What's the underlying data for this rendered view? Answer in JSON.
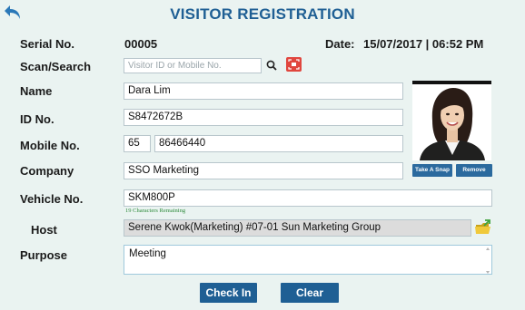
{
  "header": {
    "title": "VISITOR REGISTRATION"
  },
  "serial": {
    "label": "Serial No.",
    "value": "00005"
  },
  "date": {
    "label": "Date:",
    "value": "15/07/2017 | 06:52 PM"
  },
  "scan": {
    "label": "Scan/Search",
    "placeholder": "Visitor ID or Mobile No."
  },
  "name": {
    "label": "Name",
    "value": "Dara Lim"
  },
  "id_no": {
    "label": "ID No.",
    "value": "S8472672B"
  },
  "mobile": {
    "label": "Mobile No.",
    "country_code": "65",
    "number": "86466440"
  },
  "company": {
    "label": "Company",
    "value": "SSO Marketing"
  },
  "vehicle": {
    "label": "Vehicle No.",
    "value": "SKM800P",
    "hint": "19 Characters Remaining"
  },
  "host": {
    "label": "Host",
    "value": "Serene Kwok(Marketing) #07-01 Sun Marketing Group"
  },
  "purpose": {
    "label": "Purpose",
    "value": "Meeting"
  },
  "photo_buttons": {
    "snap": "Take A Snap",
    "remove": "Remove"
  },
  "actions": {
    "check_in": "Check In",
    "clear": "Clear"
  },
  "colors": {
    "accent": "#1f5f94",
    "background": "#eaf3f1",
    "hint": "#2e8b3b"
  }
}
